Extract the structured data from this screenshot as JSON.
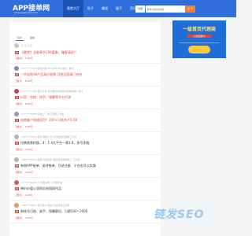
{
  "header": {
    "logo": "APP接单网",
    "logo_sub": "www.appjiedan.com",
    "nav": [
      "悬赏大厅",
      "帖子",
      "赚道",
      "猫子",
      "资讯",
      "APP下载"
    ],
    "search_select": "全部",
    "search_placeholder": "搜索关键词内容",
    "search_button": "搜 索"
  },
  "tabs": [
    "综合",
    "最新"
  ],
  "posts": [
    {
      "meta": "大 正 打字",
      "badge": "米",
      "title": "【悬赏】全能高手CPA富聚，赚客请进!!",
      "style": "red",
      "bonus": "米 0",
      "bounty": "5.00元",
      "avatar_color": "#c9c9c9"
    },
    {
      "meta": "177****7109 微微众做 2021年16时 发布了悬赏",
      "badge": "米",
      "title": "一步走推SK产品高价收购 月结全国高门合作",
      "style": "red",
      "bonus": "米 0",
      "bounty": "8.00元",
      "avatar_color": "#7e8bb1"
    },
    {
      "meta": "177****7198 聚影云商 点击要出的网络优秀组织推广案件",
      "badge": "米",
      "title": "抖音、合拍、快手、城脚等平台代流",
      "style": "red",
      "bonus": "米 0",
      "bounty": "8.00元",
      "avatar_color": "#c23b6d"
    },
    {
      "meta": "177****6908 掌金上门 网上回报工作室",
      "badge": "米",
      "title": "电商客户网络项目？200+日结共产5-5K",
      "style": "red",
      "bonus": "米 0",
      "bounty": "5.00元",
      "avatar_color": "#8a9ab8"
    },
    {
      "meta": "186****3171 悬掌 我的小手 文件全网日理的工作室",
      "badge": "米",
      "title": "拉稿视频样版，4：1:4大平台一票1.8，多号多路",
      "style": "plain",
      "bonus": "米 0",
      "bounty": "4.00元",
      "avatar_color": "#aab3c4"
    },
    {
      "meta": "186****9999 拓展 北京精英 美团自营理有网上 工作室",
      "badge": "米",
      "title": "有偿APP接单、阅评推单、日结注册、小白也可以实操",
      "style": "plain",
      "bonus": "米 0",
      "bounty": "4.00元",
      "avatar_color": "#c2b19d"
    },
    {
      "meta": "177****6908 大 优胜好帐 工作室主任",
      "badge": "米",
      "title": "单价价值公里网交易园网作品",
      "style": "plain",
      "bonus": "米 0",
      "bounty": "4.00元",
      "avatar_color": "#d35b5b"
    },
    {
      "meta": "186****8917 网上客户 微信 日业处理工作室",
      "badge": "米",
      "title": "新帐号日结、放手、保酬薪但、日薪500~2000",
      "style": "plain",
      "bonus": "米 0",
      "bounty": "4.00元",
      "avatar_color": "#d9a070"
    }
  ],
  "ad": {
    "title": "一级首页代理商",
    "subtitle": "火热招募中"
  },
  "watermark": "链发SEO",
  "colors": {
    "header": "#2f6edb",
    "accent_red": "#e0433a",
    "search_btn": "#ff7a1a"
  }
}
